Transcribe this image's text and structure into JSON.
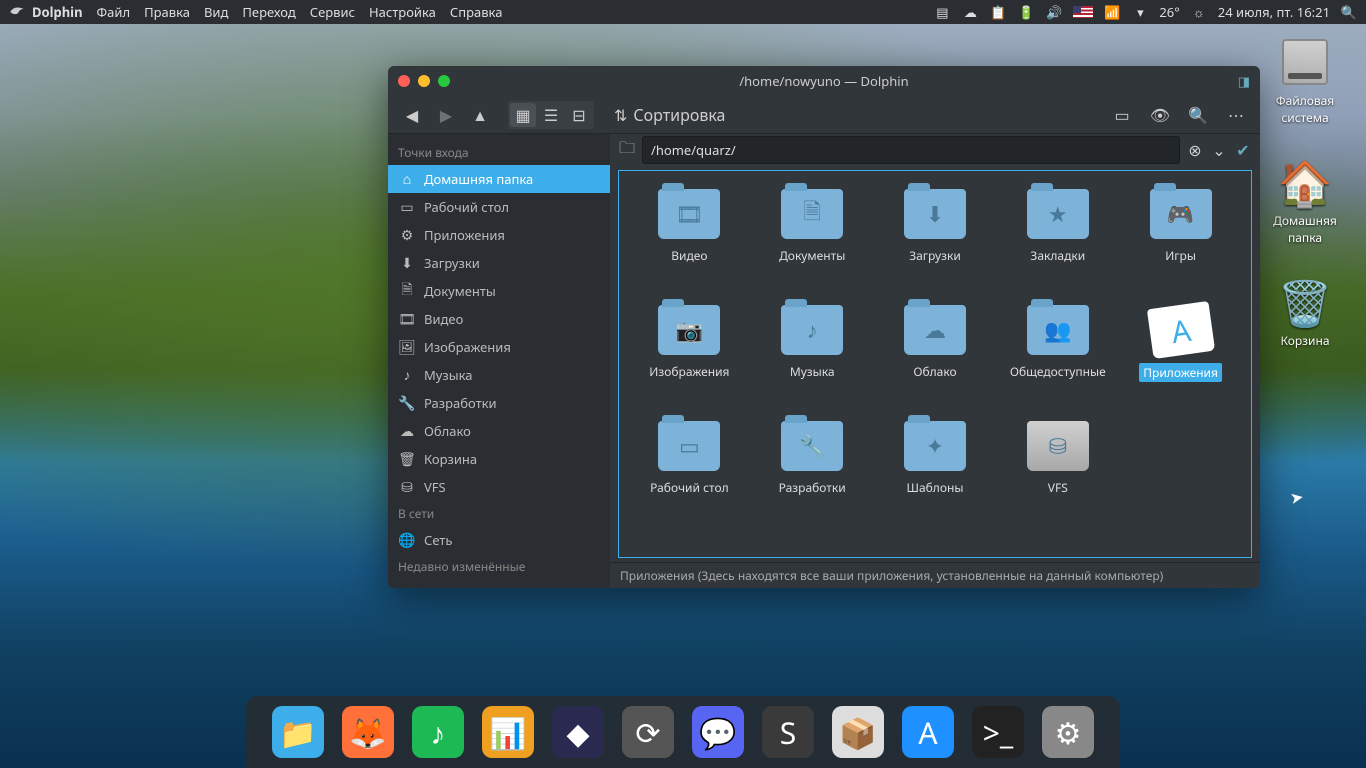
{
  "topbar": {
    "app_name": "Dolphin",
    "menus": [
      "Файл",
      "Правка",
      "Вид",
      "Переход",
      "Сервис",
      "Настройка",
      "Справка"
    ],
    "weather": "26°",
    "datetime": "24 июля, пт. 16:21"
  },
  "desktop": {
    "icons": [
      {
        "id": "filesystem",
        "label": "Файловая\nсистема",
        "type": "hdd"
      },
      {
        "id": "home",
        "label": "Домашняя\nпапка",
        "type": "home"
      },
      {
        "id": "trash",
        "label": "Корзина",
        "type": "trash"
      }
    ]
  },
  "window": {
    "title": "/home/nowyuno — Dolphin",
    "sort_label": "Сортировка",
    "location": "/home/quarz/",
    "statusbar": "Приложения (Здесь находятся все ваши приложения, установленные на данный компьютер)",
    "sidebar": {
      "section_places": "Точки входа",
      "places": [
        {
          "id": "home",
          "label": "Домашняя папка",
          "active": true,
          "icon": "home"
        },
        {
          "id": "desktop",
          "label": "Рабочий стол",
          "icon": "desktop"
        },
        {
          "id": "apps",
          "label": "Приложения",
          "icon": "apps"
        },
        {
          "id": "downloads",
          "label": "Загрузки",
          "icon": "download"
        },
        {
          "id": "documents",
          "label": "Документы",
          "icon": "doc"
        },
        {
          "id": "video",
          "label": "Видео",
          "icon": "video"
        },
        {
          "id": "images",
          "label": "Изображения",
          "icon": "image"
        },
        {
          "id": "music",
          "label": "Музыка",
          "icon": "music"
        },
        {
          "id": "dev",
          "label": "Разработки",
          "icon": "dev"
        },
        {
          "id": "cloud",
          "label": "Облако",
          "icon": "cloud"
        },
        {
          "id": "trash",
          "label": "Корзина",
          "icon": "trash"
        },
        {
          "id": "vfs",
          "label": "VFS",
          "icon": "hdd"
        }
      ],
      "section_network": "В сети",
      "network": [
        {
          "id": "net",
          "label": "Сеть",
          "icon": "globe"
        }
      ],
      "section_recent": "Недавно изменённые"
    },
    "files": [
      {
        "id": "video",
        "label": "Видео",
        "icon": "video"
      },
      {
        "id": "documents",
        "label": "Документы",
        "icon": "doc"
      },
      {
        "id": "downloads",
        "label": "Загрузки",
        "icon": "download"
      },
      {
        "id": "bookmarks",
        "label": "Закладки",
        "icon": "star"
      },
      {
        "id": "games",
        "label": "Игры",
        "icon": "game"
      },
      {
        "id": "images",
        "label": "Изображения",
        "icon": "camera"
      },
      {
        "id": "music",
        "label": "Музыка",
        "icon": "music"
      },
      {
        "id": "cloud",
        "label": "Облако",
        "icon": "cloud"
      },
      {
        "id": "public",
        "label": "Общедоступные",
        "icon": "people"
      },
      {
        "id": "apps",
        "label": "Приложения",
        "icon": "app",
        "selected": true
      },
      {
        "id": "desktop",
        "label": "Рабочий стол",
        "icon": "desktop"
      },
      {
        "id": "dev",
        "label": "Разработки",
        "icon": "dev"
      },
      {
        "id": "templates",
        "label": "Шаблоны",
        "icon": "template"
      },
      {
        "id": "vfs",
        "label": "VFS",
        "icon": "hdd",
        "hdd": true
      }
    ]
  },
  "dock": [
    {
      "id": "dolphin",
      "color": "#3daee9",
      "glyph": "📁"
    },
    {
      "id": "firefox",
      "color": "#ff7139",
      "glyph": "🦊"
    },
    {
      "id": "spotify",
      "color": "#1db954",
      "glyph": "♪"
    },
    {
      "id": "office",
      "color": "#f0a020",
      "glyph": "📊"
    },
    {
      "id": "inkscape",
      "color": "#2a2a50",
      "glyph": "◆"
    },
    {
      "id": "steam",
      "color": "#555",
      "glyph": "⟳"
    },
    {
      "id": "discord",
      "color": "#5865f2",
      "glyph": "💬"
    },
    {
      "id": "sublime",
      "color": "#3a3a3a",
      "glyph": "S"
    },
    {
      "id": "virtualbox",
      "color": "#ddd",
      "glyph": "📦"
    },
    {
      "id": "appstore",
      "color": "#1e90ff",
      "glyph": "A"
    },
    {
      "id": "terminal",
      "color": "#222",
      "glyph": ">_"
    },
    {
      "id": "settings",
      "color": "#888",
      "glyph": "⚙"
    }
  ],
  "icons_map": {
    "home": "⌂",
    "desktop": "▭",
    "apps": "⚙",
    "download": "⬇",
    "doc": "🗎",
    "video": "🎞",
    "image": "🖼",
    "music": "♪",
    "dev": "🔧",
    "cloud": "☁",
    "trash": "🗑",
    "hdd": "⛁",
    "globe": "🌐",
    "star": "★",
    "game": "🎮",
    "camera": "📷",
    "people": "👥",
    "app": "A",
    "template": "✦"
  }
}
